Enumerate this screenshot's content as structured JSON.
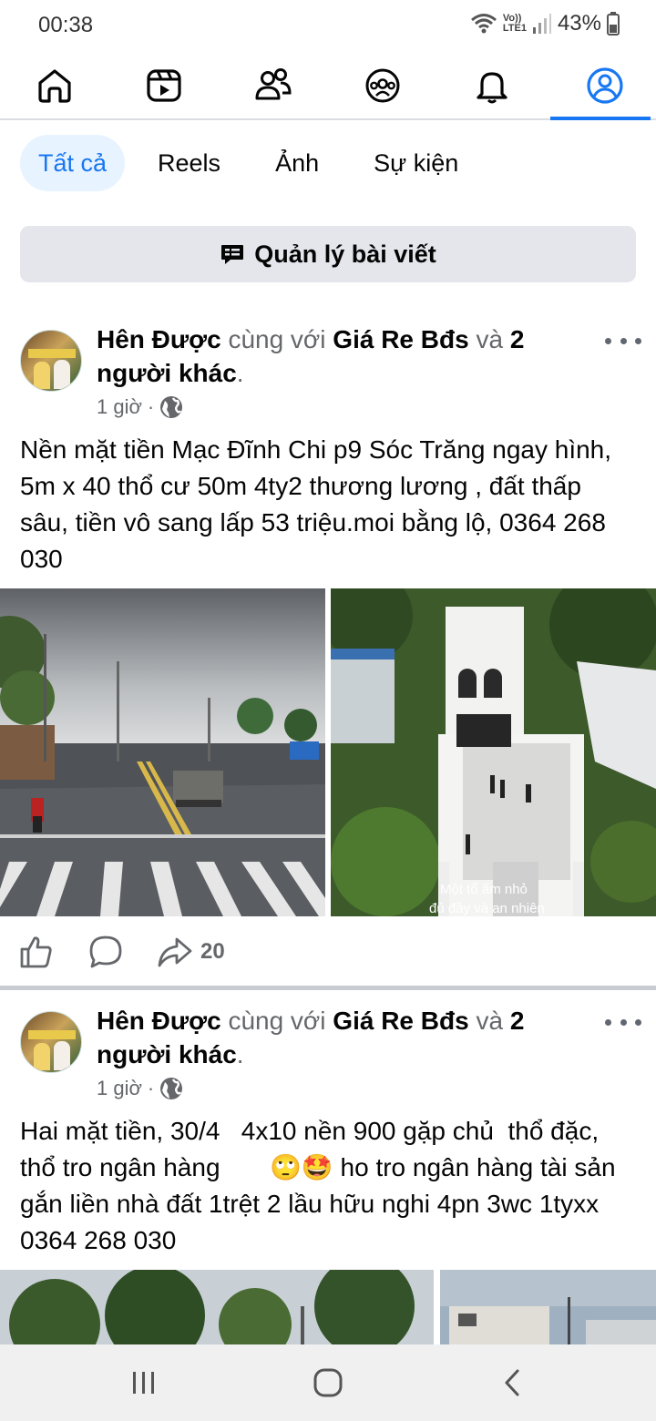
{
  "status": {
    "time": "00:38",
    "network_top": "Vo))",
    "network_bottom": "LTE1",
    "battery": "43%"
  },
  "topnav": {
    "tabs": [
      {
        "icon": "home-icon"
      },
      {
        "icon": "reels-icon"
      },
      {
        "icon": "friends-icon"
      },
      {
        "icon": "groups-icon"
      },
      {
        "icon": "notifications-icon"
      },
      {
        "icon": "profile-icon",
        "active": true
      }
    ],
    "accent": "#1877f2"
  },
  "filters": [
    {
      "label": "Tất cả",
      "active": true
    },
    {
      "label": "Reels"
    },
    {
      "label": "Ảnh"
    },
    {
      "label": "Sự kiện"
    }
  ],
  "manage_button": {
    "label": "Quản lý bài viết",
    "icon": "manage-posts-icon"
  },
  "posts": [
    {
      "author": "Hên Được",
      "with_word": "cùng với",
      "tagged": "Giá Re Bđs",
      "and_word": "và",
      "others": "2 người khác",
      "period": ".",
      "time": "1 giờ",
      "sep": "·",
      "privacy_icon": "globe-icon",
      "text": "Nền mặt tiền Mạc Đĩnh Chi p9 Sóc Trăng ngay hình,  5m x 40 thổ cư 50m  4ty2 thương lương , đất thấp sâu, tiền vô sang lấp 53 triệu.moi bằng lộ, 0364 268 030",
      "photos": [
        {
          "kind": "street-photo"
        },
        {
          "kind": "aerial-house-photo",
          "caption_line1": "Một tổ ấm nhỏ",
          "caption_line2": "đủ đầy và an nhiên"
        }
      ],
      "share_count": "20"
    },
    {
      "author": "Hên Được",
      "with_word": "cùng với",
      "tagged": "Giá Re Bđs",
      "and_word": "và",
      "others": "2 người khác",
      "period": ".",
      "time": "1 giờ",
      "sep": "·",
      "privacy_icon": "globe-icon",
      "text_part1": "Hai mặt tiền, 30/4   4x10 nền 900 gặp chủ  thổ đặc,   thổ tro ngân hàng       ",
      "text_emoji1": "🙄",
      "text_emoji2": "🤩",
      "text_part2": " ho tro ngân hàng tài sản gắn liền nhà đất 1trệt 2 lầu hữu nghi 4pn 3wc 1tyxx 0364 268 030",
      "photos": [
        {
          "kind": "trees-photo"
        },
        {
          "kind": "building-photo"
        }
      ]
    }
  ],
  "system_nav": [
    {
      "icon": "recent-apps-icon"
    },
    {
      "icon": "home-circle-icon"
    },
    {
      "icon": "back-icon"
    }
  ]
}
